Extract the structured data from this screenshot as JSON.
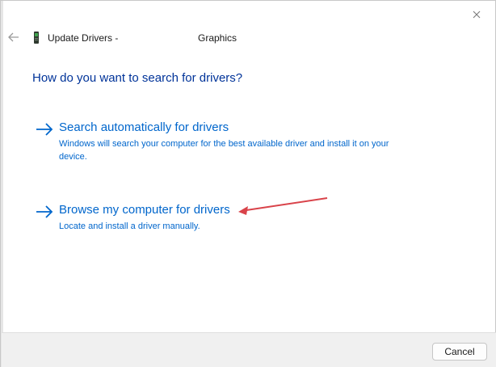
{
  "window": {
    "title": "Update Drivers -",
    "device_name": "Graphics",
    "icons": {
      "back": "back-arrow-icon",
      "close": "close-icon",
      "device": "graphics-device-icon"
    }
  },
  "main": {
    "heading": "How do you want to search for drivers?",
    "options": [
      {
        "title": "Search automatically for drivers",
        "description": "Windows will search your computer for the best available driver and install it on your device."
      },
      {
        "title": "Browse my computer for drivers",
        "description": "Locate and install a driver manually."
      }
    ]
  },
  "footer": {
    "cancel_label": "Cancel"
  },
  "colors": {
    "heading": "#003399",
    "link": "#0066cc",
    "annotation_arrow": "#d9434a",
    "footer_bg": "#f0f0f0"
  }
}
